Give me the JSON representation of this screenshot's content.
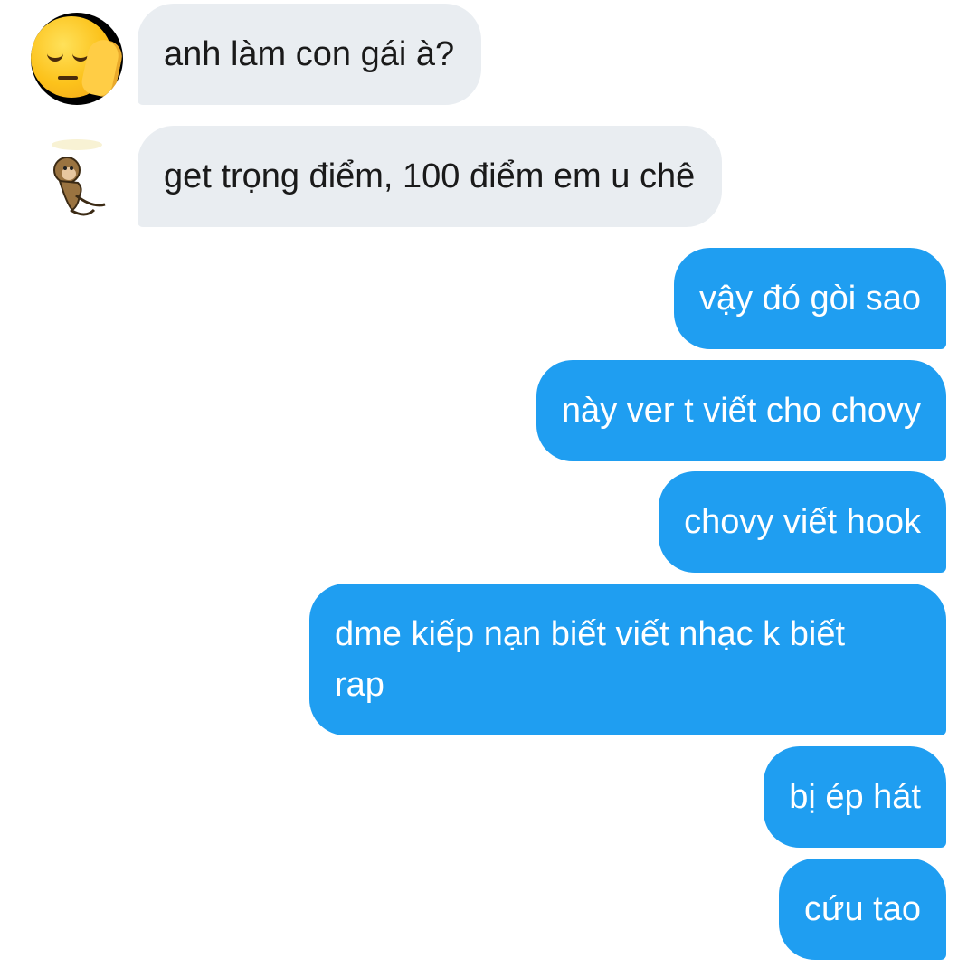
{
  "conversation": {
    "messages": [
      {
        "sender": "other",
        "avatar": "pensive-face-with-hand-icon",
        "text": "anh làm con gái à?"
      },
      {
        "sender": "other",
        "avatar": "monkey-sticker-icon",
        "text": "get trọng điểm, 100 điểm em u chê"
      },
      {
        "sender": "me",
        "text": "vậy đó gòi sao"
      },
      {
        "sender": "me",
        "text": "này ver t viết cho chovy"
      },
      {
        "sender": "me",
        "text": "chovy viết hook"
      },
      {
        "sender": "me",
        "text": "dme kiếp nạn biết viết nhạc k biết rap"
      },
      {
        "sender": "me",
        "text": "bị ép hát"
      },
      {
        "sender": "me",
        "text": "cứu tao"
      }
    ]
  },
  "colors": {
    "incoming_bubble": "#e9edf1",
    "outgoing_bubble": "#1f9ef1",
    "background": "#ffffff"
  }
}
